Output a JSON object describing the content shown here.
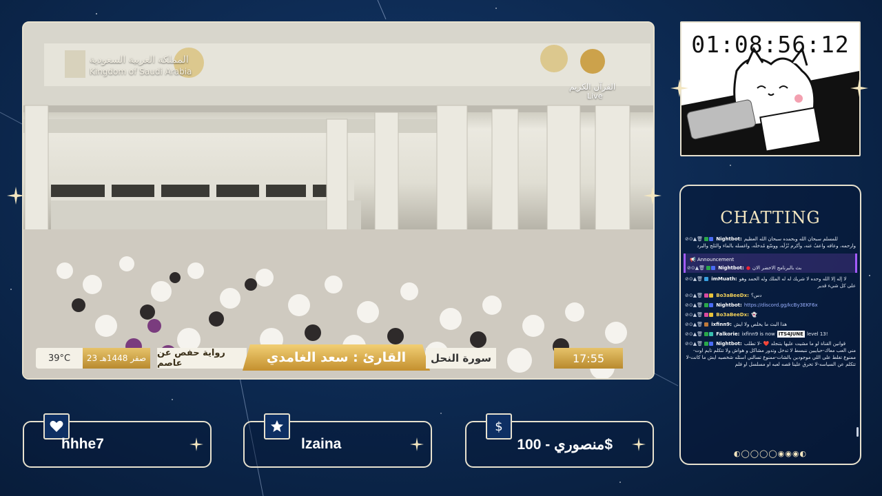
{
  "video": {
    "channel_logo_ar": "المملكة العربية السعودية",
    "channel_logo_en": "Kingdom of Saudi Arabia",
    "live_ar": "القرآن الكريم",
    "live_en": "Live",
    "lower_third": {
      "temperature": "39°C",
      "hijri_date": "23 صفر 1448هـ",
      "narration": "رواية حفص عن عاصم",
      "reader": "القارئ : سعد الغامدي",
      "surah": "سورة النحل",
      "time": "17:55"
    }
  },
  "timer": {
    "value": "01:08:56:12"
  },
  "chat": {
    "title": "CHATTING",
    "messages": [
      {
        "user": "Nightbot:",
        "text": "للمسلم سبحان الله وبحمده سبحان الله العظيم",
        "extra": "وارحمه، وعافه واعفُ عنه، وأكرم نُزُلَه، ووسّع مُدخلَه، واغسله بالماء والثلج والبرد"
      },
      {
        "announcement_label": "Announcement",
        "user": "Nightbot:",
        "text": "بث بالبرنامج الاخضر الان"
      },
      {
        "user": "imMuath:",
        "text": "لا إله إلا الله وحده لا شريك له له الملك وله الحمد وهو",
        "extra": "على كل شيء قدير"
      },
      {
        "user": "Bo3aBeeDx:",
        "text": "دس؟"
      },
      {
        "user": "Nightbot:",
        "text": "https://discord.gg/kcBy3EKF6x"
      },
      {
        "user": "Bo3aBeeDx:",
        "text": "👻"
      },
      {
        "user": "ixfinn9:",
        "text": "هذا البث ما يخلص ولا ايش"
      },
      {
        "user": "Falkorie:",
        "text": "ixfinn9 is now",
        "badge": "ITS4JUNE",
        "after": "level 13!"
      },
      {
        "user": "Nightbot:",
        "text": "قوانين القناة لو ما مشيت عليها بتنجلد ❤️ -لا تطلب",
        "extra": "مني العب معاك-حبايبين ننبسط لا تدخل وتدور مشاكل و هواش ولا تتكلم تايم اوت-ممنوع تغلط على اللي موجودين بالشات-ممنوع تسالني اسئله شخصيه ايش ما كانت-لا تتكلم عن السياسه-لا تحرق علينا قصه لعبه او مسلسل او فلم"
      }
    ],
    "page_indicator": "◐◯◯◯◯◉◉◉◐"
  },
  "bottom": {
    "follower": "hhhe7",
    "subscriber": "lzaina",
    "donation": "منصوري - 100$",
    "donation_icon": "$"
  },
  "icons": {
    "follower": "heart-icon",
    "subscriber": "star-icon",
    "donation": "dollar-icon"
  },
  "colors": {
    "background": "#0d2a52",
    "frame": "#e8e2cf",
    "gold": "#d4a646"
  }
}
